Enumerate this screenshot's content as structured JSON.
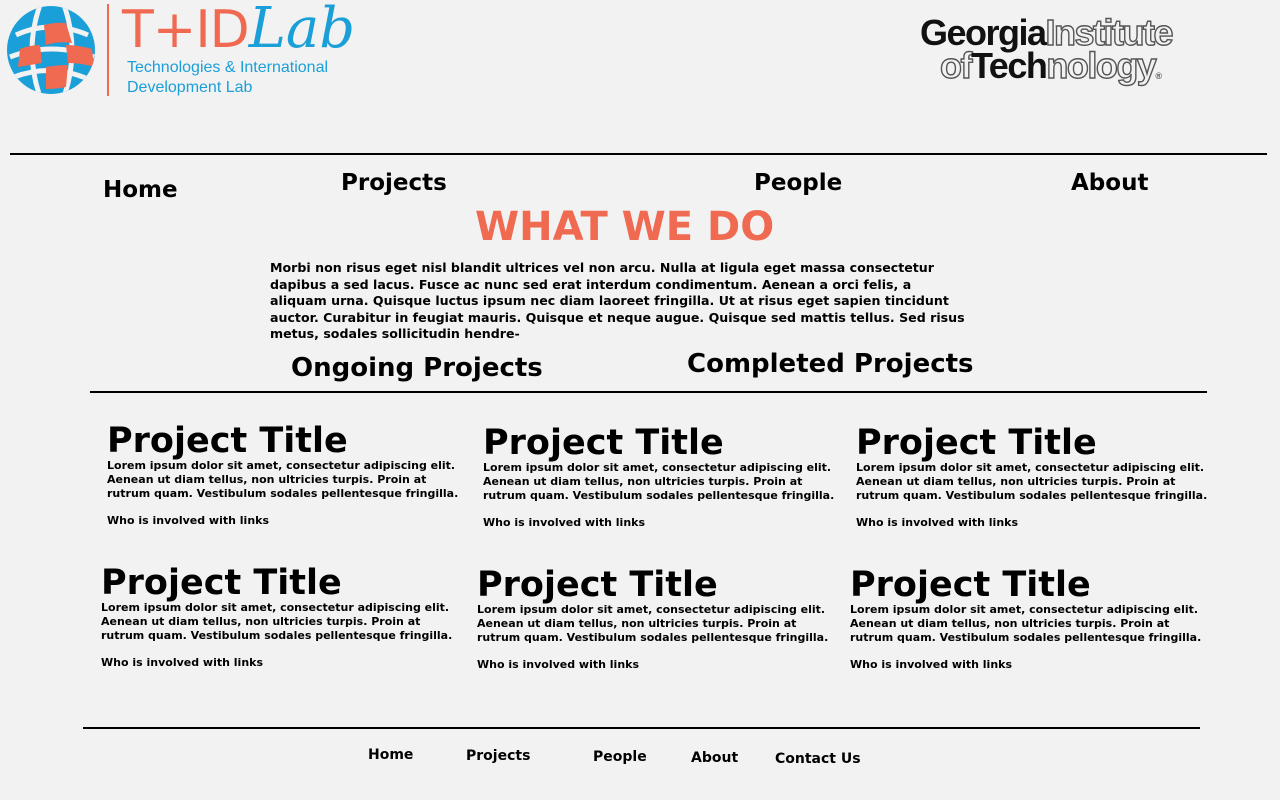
{
  "header": {
    "logo": {
      "brand_prefix": "T+ID",
      "brand_suffix": "Lab",
      "subtitle_line1": "Technologies & International",
      "subtitle_line2": "Development Lab",
      "icon": "globe-icon",
      "colors": {
        "orange": "#ef6a50",
        "blue": "#1a9fd8"
      }
    },
    "partner_logo": {
      "line1_solid": "Georgia",
      "line1_outline": "Institute",
      "line2_outline": "of",
      "line2_solid": "Tech",
      "line2_outline_end": "nology",
      "registered": "®"
    }
  },
  "nav": {
    "items": [
      "Home",
      "Projects",
      "People",
      "About"
    ]
  },
  "main": {
    "heading": "WHAT WE DO",
    "intro": "Morbi non risus eget nisl blandit ultrices vel non arcu. Nulla at ligula eget massa consectetur dapibus a sed lacus. Fusce ac nunc sed erat interdum condimentum. Aenean a orci felis, a aliquam urna. Quisque luctus ipsum nec diam laoreet fringilla. Ut at risus eget sapien tincidunt auctor. Curabitur in feugiat mauris. Quisque et neque augue. Quisque sed mattis tellus. Sed risus metus, sodales sollicitudin hendre-",
    "tabs": [
      "Ongoing Projects",
      "Completed Projects"
    ],
    "projects": [
      {
        "title": "Project Title",
        "description": "Lorem ipsum dolor sit amet, consectetur adipiscing elit. Aenean ut diam tellus, non ultricies turpis. Proin at rutrum quam. Vestibulum sodales pellentesque fringilla.",
        "who": "Who is involved with links"
      },
      {
        "title": "Project Title",
        "description": "Lorem ipsum dolor sit amet, consectetur adipiscing elit. Aenean ut diam tellus, non ultricies turpis. Proin at rutrum quam. Vestibulum sodales pellentesque fringilla.",
        "who": "Who is involved with links"
      },
      {
        "title": "Project Title",
        "description": "Lorem ipsum dolor sit amet, consectetur adipiscing elit. Aenean ut diam tellus, non ultricies turpis. Proin at rutrum quam. Vestibulum sodales pellentesque fringilla.",
        "who": "Who is involved with links"
      },
      {
        "title": "Project Title",
        "description": "Lorem ipsum dolor sit amet, consectetur adipiscing elit. Aenean ut diam tellus, non ultricies turpis. Proin at rutrum quam. Vestibulum sodales pellentesque fringilla.",
        "who": "Who is involved with links"
      },
      {
        "title": "Project Title",
        "description": "Lorem ipsum dolor sit amet, consectetur adipiscing elit. Aenean ut diam tellus, non ultricies turpis. Proin at rutrum quam. Vestibulum sodales pellentesque fringilla.",
        "who": "Who is involved with links"
      },
      {
        "title": "Project Title",
        "description": "Lorem ipsum dolor sit amet, consectetur adipiscing elit. Aenean ut diam tellus, non ultricies turpis. Proin at rutrum quam. Vestibulum sodales pellentesque fringilla.",
        "who": "Who is involved with links"
      }
    ]
  },
  "footer": {
    "links": [
      "Home",
      "Projects",
      "People",
      "About",
      "Contact Us"
    ]
  }
}
